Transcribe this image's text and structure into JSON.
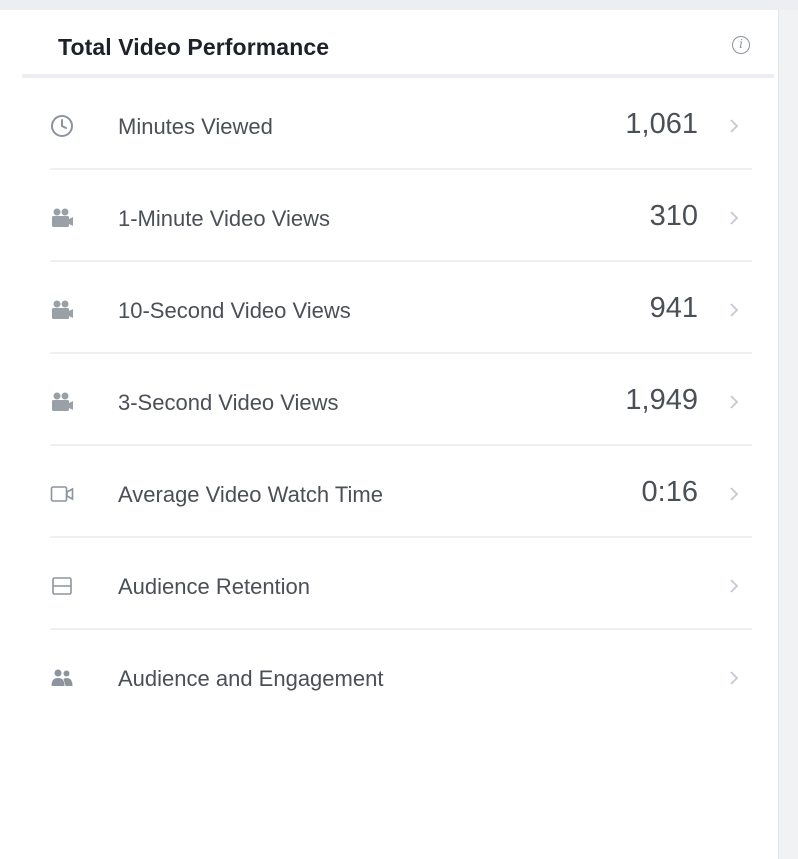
{
  "panel": {
    "title": "Total Video Performance",
    "info_icon": "info-icon"
  },
  "rows": [
    {
      "icon": "clock-icon",
      "label": "Minutes Viewed",
      "value": "1,061"
    },
    {
      "icon": "video-views-icon",
      "label": "1-Minute Video Views",
      "value": "310"
    },
    {
      "icon": "video-views-icon",
      "label": "10-Second Video Views",
      "value": "941"
    },
    {
      "icon": "video-views-icon",
      "label": "3-Second Video Views",
      "value": "1,949"
    },
    {
      "icon": "video-camera-icon",
      "label": "Average Video Watch Time",
      "value": "0:16"
    },
    {
      "icon": "retention-icon",
      "label": "Audience Retention",
      "value": ""
    },
    {
      "icon": "people-icon",
      "label": "Audience and Engagement",
      "value": ""
    }
  ],
  "colors": {
    "text": "#4b4f56",
    "title": "#1d2129",
    "icon": "#8d949e",
    "divider": "#eef0f3"
  }
}
